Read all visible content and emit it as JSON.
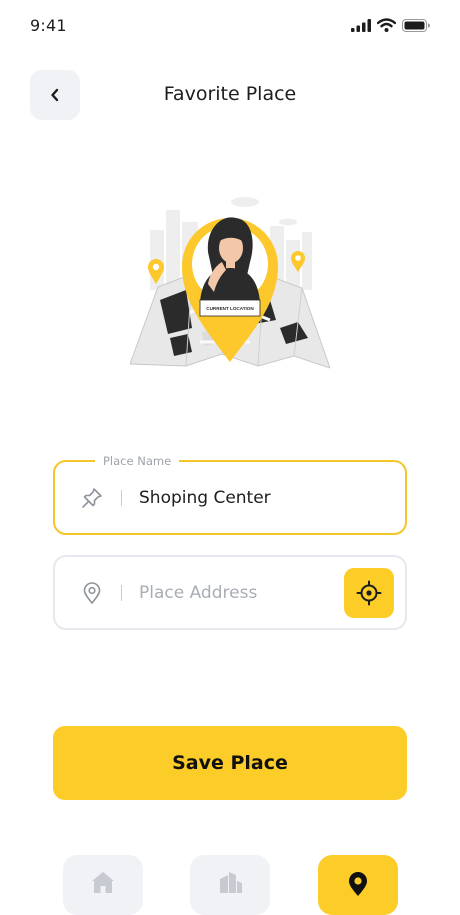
{
  "status_bar": {
    "time": "9:41",
    "icons": [
      "signal-icon",
      "wifi-icon",
      "battery-icon"
    ]
  },
  "header": {
    "title": "Favorite Place",
    "back_icon": "chevron-left-icon"
  },
  "illustration": {
    "caption": "CURRENT LOCATION",
    "colors": {
      "accent": "#fcc82c",
      "map": "#e9e9e9",
      "dark": "#2b2b2b"
    }
  },
  "form": {
    "place_name": {
      "label": "Place Name",
      "value": "Shoping Center",
      "icon": "pin-icon"
    },
    "place_address": {
      "placeholder": "Place Address",
      "icon": "location-pin-icon",
      "action_icon": "crosshair-icon"
    }
  },
  "save_button": {
    "label": "Save Place"
  },
  "bottom_nav": [
    {
      "name": "home",
      "icon": "home-icon",
      "active": false
    },
    {
      "name": "buildings",
      "icon": "building-icon",
      "active": false
    },
    {
      "name": "location",
      "icon": "location-pin-icon",
      "active": true
    }
  ],
  "colors": {
    "accent": "#fccc29",
    "field_border_active": "#f5c629",
    "field_border": "#e6e8ee",
    "muted_bg": "#f1f2f6"
  }
}
